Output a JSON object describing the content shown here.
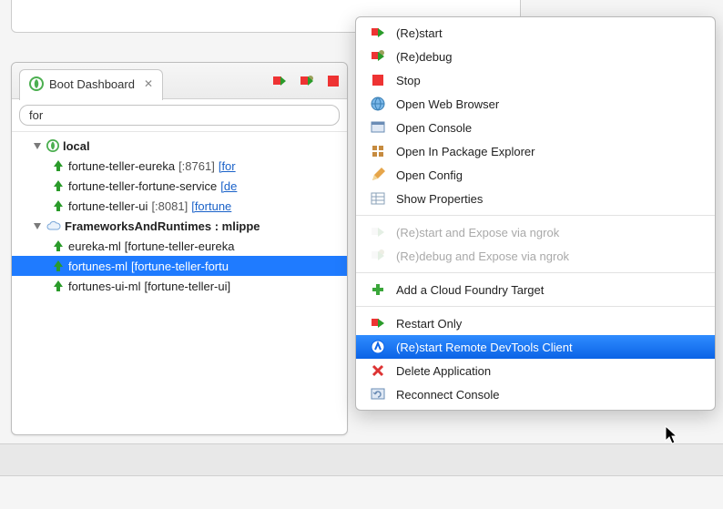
{
  "tab": {
    "title": "Boot Dashboard",
    "close": "✕"
  },
  "filter": {
    "value": "for"
  },
  "tree": {
    "group_local": "local",
    "local_items": [
      {
        "name": "fortune-teller-eureka",
        "port": "[:8761]",
        "link": "[for"
      },
      {
        "name": "fortune-teller-fortune-service",
        "link": "[de"
      },
      {
        "name": "fortune-teller-ui",
        "port": "[:8081]",
        "link": "[fortune"
      }
    ],
    "group_cf": "FrameworksAndRuntimes : mlippe",
    "cf_items": [
      {
        "name": "eureka-ml",
        "suffix": "[fortune-teller-eureka"
      },
      {
        "name": "fortunes-ml",
        "suffix": "[fortune-teller-fortu",
        "selected": true
      },
      {
        "name": "fortunes-ui-ml",
        "suffix": "[fortune-teller-ui]"
      }
    ]
  },
  "menu": {
    "items": [
      {
        "icon": "run",
        "label": "(Re)start"
      },
      {
        "icon": "debug",
        "label": "(Re)debug"
      },
      {
        "icon": "stop",
        "label": "Stop"
      },
      {
        "icon": "globe",
        "label": "Open Web Browser"
      },
      {
        "icon": "console",
        "label": "Open Console"
      },
      {
        "icon": "package",
        "label": "Open In Package Explorer"
      },
      {
        "icon": "pencil",
        "label": "Open Config"
      },
      {
        "icon": "props",
        "label": "Show Properties"
      },
      {
        "sep": true
      },
      {
        "icon": "run",
        "label": "(Re)start and Expose via ngrok",
        "disabled": true
      },
      {
        "icon": "debug",
        "label": "(Re)debug and Expose via ngrok",
        "disabled": true
      },
      {
        "sep": true
      },
      {
        "icon": "plus",
        "label": "Add a Cloud Foundry Target"
      },
      {
        "sep": true
      },
      {
        "icon": "run",
        "label": "Restart Only"
      },
      {
        "icon": "devtools",
        "label": "(Re)start Remote DevTools Client",
        "selected": true
      },
      {
        "icon": "delete",
        "label": "Delete Application"
      },
      {
        "icon": "reconnect",
        "label": "Reconnect Console"
      }
    ]
  }
}
